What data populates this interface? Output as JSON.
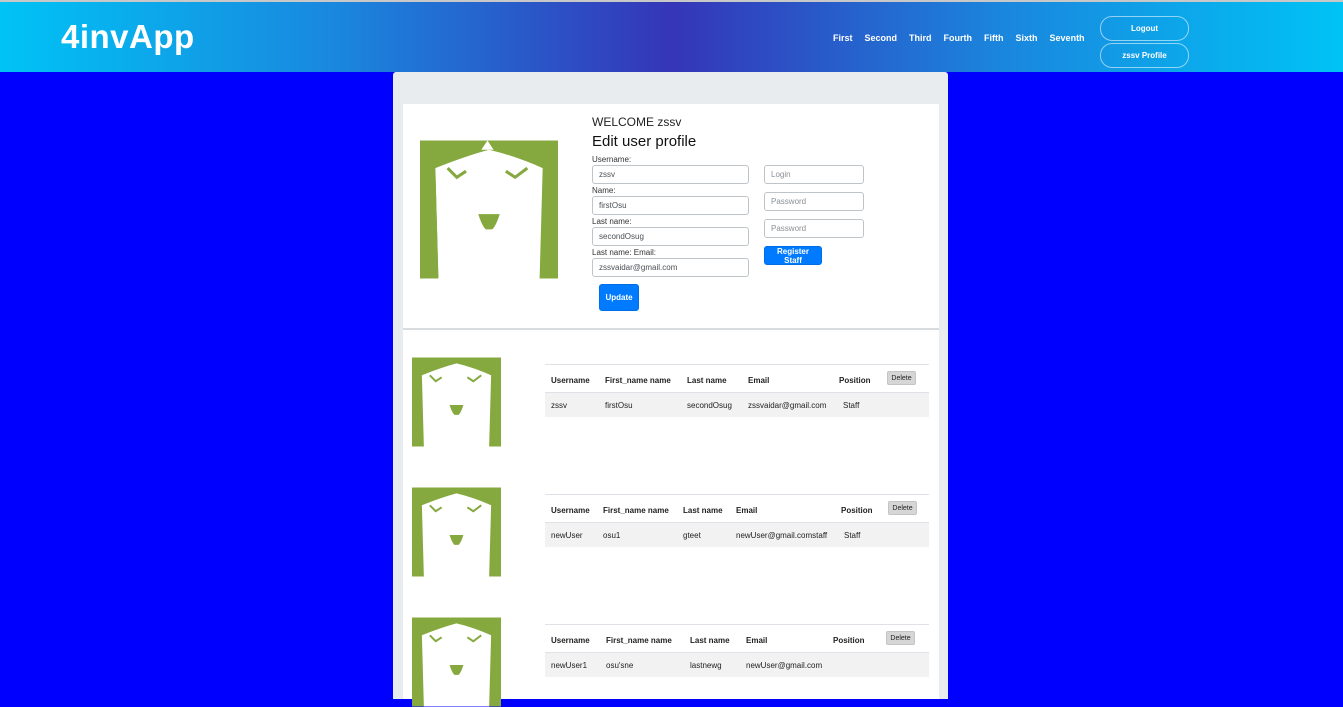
{
  "header": {
    "brand": "4invApp",
    "nav": [
      "First",
      "Second",
      "Third",
      "Fourth",
      "Fifth",
      "Sixth",
      "Seventh"
    ],
    "logout_label": "Logout",
    "profile_label": "zssv Profile"
  },
  "profile": {
    "welcome": "WELCOME zssv",
    "title": "Edit user profile",
    "fields": [
      {
        "label": "Username:",
        "value": "zssv"
      },
      {
        "label": "Name:",
        "value": "firstOsu"
      },
      {
        "label": "Last name:",
        "value": "secondOsug"
      },
      {
        "label": "Last name: Email:",
        "value": "zssvaidar@gmail.com"
      }
    ],
    "update_label": "Update"
  },
  "register": {
    "login_placeholder": "Login",
    "password_placeholder": "Password",
    "password2_placeholder": "Password",
    "button_label": "Register Staff"
  },
  "users": {
    "columns": [
      "Username",
      "First_name name",
      "Last name",
      "Email",
      "Position"
    ],
    "delete_label": "Delete",
    "rows": [
      {
        "username": "zssv",
        "first_name": "firstOsu",
        "last_name": "secondOsug",
        "email": "zssvaidar@gmail.com",
        "position": "Staff"
      },
      {
        "username": "newUser",
        "first_name": "osu1",
        "last_name": "gteet",
        "email": "newUser@gmail.comstaff",
        "position": "Staff"
      },
      {
        "username": "newUser1",
        "first_name": "osu'sne",
        "last_name": "lastnewg",
        "email": "newUser@gmail.com",
        "position": ""
      }
    ]
  },
  "colors": {
    "page_bg": "#0000ff",
    "avatar_green": "#86a93f",
    "primary": "#007bff"
  }
}
